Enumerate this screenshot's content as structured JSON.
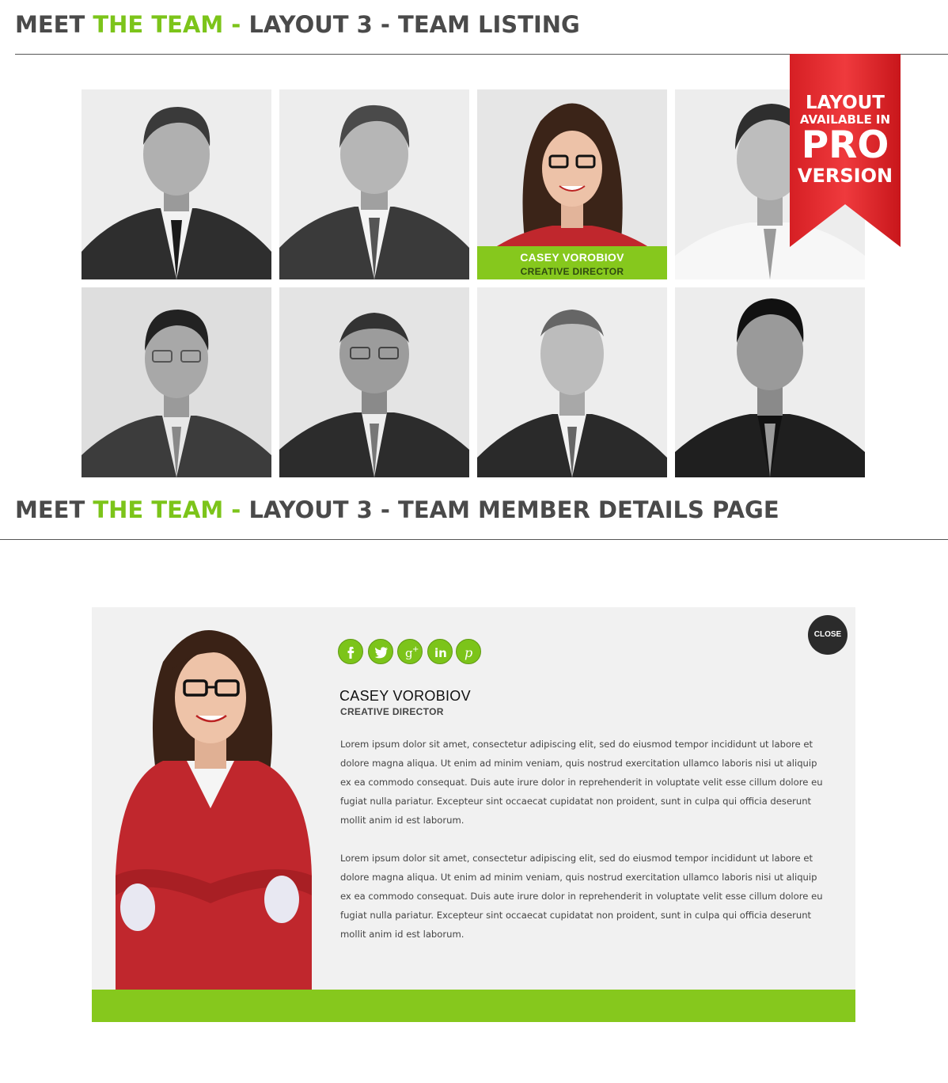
{
  "section1": {
    "title_part1": "MEET ",
    "title_part2": "THE TEAM - ",
    "title_part3": "LAYOUT 3 - TEAM LISTING"
  },
  "section2": {
    "title_part1": "MEET ",
    "title_part2": "THE TEAM - ",
    "title_part3": "LAYOUT 3 - TEAM MEMBER DETAILS PAGE"
  },
  "ribbon": {
    "line1": "LAYOUT",
    "line2": "AVAILABLE IN",
    "line3": "PRO",
    "line4": "VERSION",
    "color": "#e8262a"
  },
  "team": {
    "highlight": {
      "name": "CASEY VOROBIOV",
      "role": "CREATIVE DIRECTOR"
    }
  },
  "details": {
    "close_label": "CLOSE",
    "name": "CASEY VOROBIOV",
    "role": "CREATIVE DIRECTOR",
    "social": [
      "facebook-icon",
      "twitter-icon",
      "google-plus-icon",
      "linkedin-icon",
      "pinterest-icon"
    ],
    "bio": [
      "Lorem ipsum dolor sit amet, consectetur adipiscing elit, sed do eiusmod tempor incididunt ut labore et dolore magna aliqua. Ut enim ad minim veniam, quis nostrud exercitation ullamco laboris nisi ut aliquip ex ea commodo consequat. Duis aute irure dolor in reprehenderit in voluptate velit esse cillum dolore eu fugiat nulla pariatur. Excepteur sint occaecat cupidatat non proident, sunt in culpa qui officia deserunt mollit anim id est laborum.",
      "Lorem ipsum dolor sit amet, consectetur adipiscing elit, sed do eiusmod tempor incididunt ut labore et dolore magna aliqua. Ut enim ad minim veniam, quis nostrud exercitation ullamco laboris nisi ut aliquip ex ea commodo consequat. Duis aute irure dolor in reprehenderit in voluptate velit esse cillum dolore eu fugiat nulla pariatur. Excepteur sint occaecat cupidatat non proident, sunt in culpa qui officia deserunt mollit anim id est laborum."
    ]
  },
  "colors": {
    "accent": "#86c81d",
    "title": "#4a4a4a",
    "panel": "#f1f1f1"
  }
}
